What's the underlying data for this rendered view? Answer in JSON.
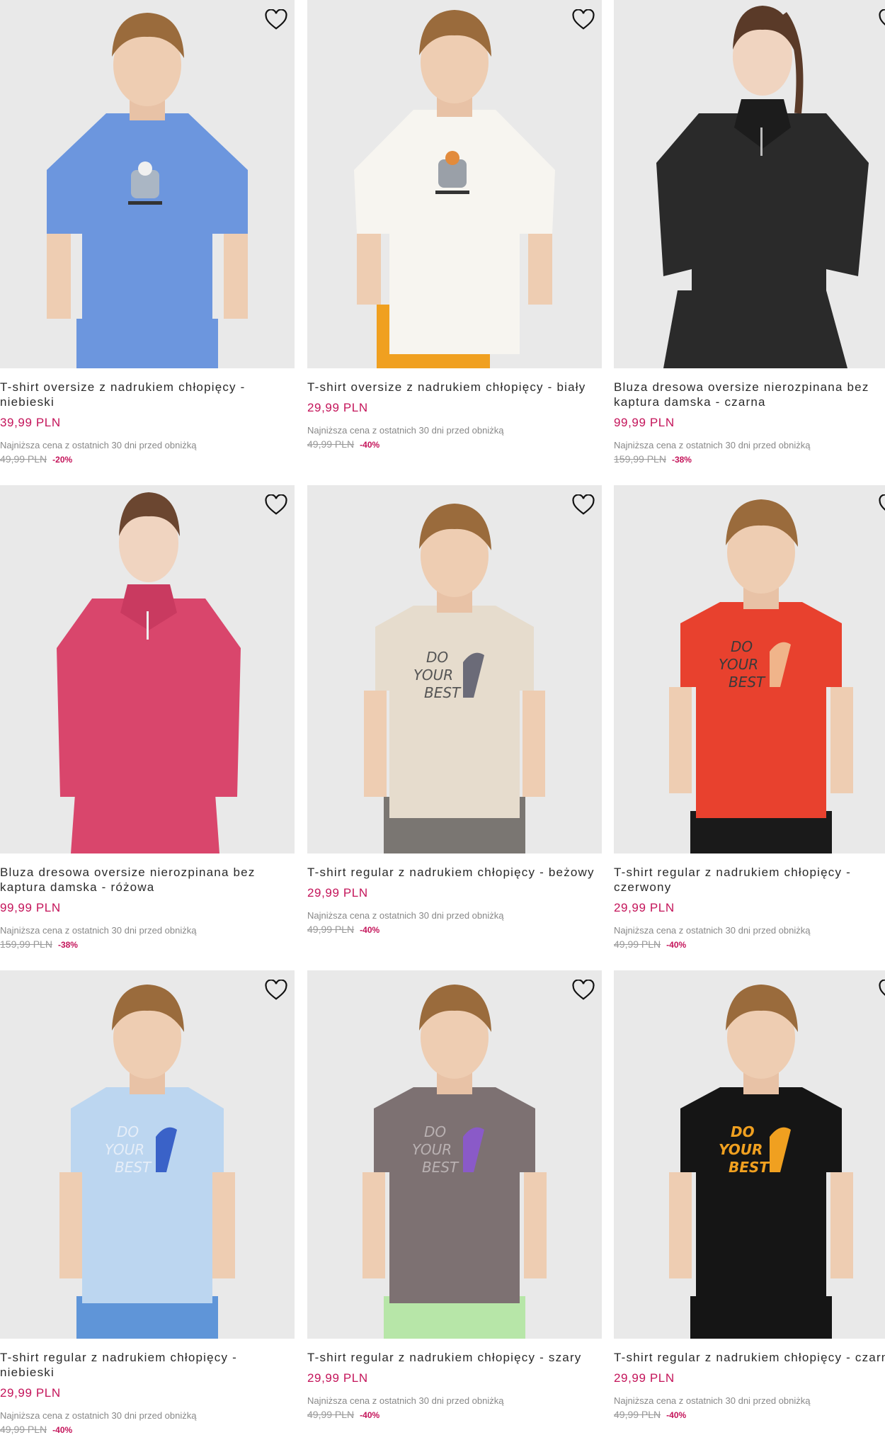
{
  "colors": {
    "price": "#c4145a",
    "card_bg": "#e9e9e9"
  },
  "products": [
    {
      "title": "T-shirt oversize z nadrukiem chłopięcy - niebieski",
      "price": "39,99 PLN",
      "lowest_label": "Najniższa cena z ostatnich 30 dni przed obniżką",
      "old_price": "49,99 PLN",
      "discount": "-20%",
      "shirt_color": "#6c96de",
      "print": "skater",
      "person": "boy",
      "bottom": "#6c96de"
    },
    {
      "title": "T-shirt oversize z nadrukiem chłopięcy - biały",
      "price": "29,99 PLN",
      "lowest_label": "Najniższa cena z ostatnich 30 dni przed obniżką",
      "old_price": "49,99 PLN",
      "discount": "-40%",
      "shirt_color": "#f7f5f0",
      "print": "skater",
      "person": "boy",
      "bottom": "#f0a020"
    },
    {
      "title": "Bluza dresowa oversize nierozpinana bez kaptura damska - czarna",
      "price": "99,99 PLN",
      "lowest_label": "Najniższa cena z ostatnich 30 dni przed obniżką",
      "old_price": "159,99 PLN",
      "discount": "-38%",
      "shirt_color": "#2a2a2a",
      "print": "zip",
      "person": "woman",
      "bottom": "#2a2a2a"
    },
    {
      "title": "Bluza dresowa oversize nierozpinana bez kaptura damska - różowa",
      "price": "99,99 PLN",
      "lowest_label": "Najniższa cena z ostatnich 30 dni przed obniżką",
      "old_price": "159,99 PLN",
      "discount": "-38%",
      "shirt_color": "#d9466c",
      "print": "zip",
      "person": "woman",
      "bottom": "#d9466c"
    },
    {
      "title": "T-shirt regular z nadrukiem chłopięcy - beżowy",
      "price": "29,99 PLN",
      "lowest_label": "Najniższa cena z ostatnich 30 dni przed obniżką",
      "old_price": "49,99 PLN",
      "discount": "-40%",
      "shirt_color": "#e6dccd",
      "print": "text",
      "person": "boy",
      "bottom": "#7a7672"
    },
    {
      "title": "T-shirt regular z nadrukiem chłopięcy - czerwony",
      "price": "29,99 PLN",
      "lowest_label": "Najniższa cena z ostatnich 30 dni przed obniżką",
      "old_price": "49,99 PLN",
      "discount": "-40%",
      "shirt_color": "#e8412e",
      "print": "text",
      "person": "boy",
      "bottom": "#1a1a1a"
    },
    {
      "title": "T-shirt regular z nadrukiem chłopięcy - niebieski",
      "price": "29,99 PLN",
      "lowest_label": "Najniższa cena z ostatnich 30 dni przed obniżką",
      "old_price": "49,99 PLN",
      "discount": "-40%",
      "shirt_color": "#bcd6f0",
      "print": "text",
      "person": "boy",
      "bottom": "#5f95d8"
    },
    {
      "title": "T-shirt regular z nadrukiem chłopięcy - szary",
      "price": "29,99 PLN",
      "lowest_label": "Najniższa cena z ostatnich 30 dni przed obniżką",
      "old_price": "49,99 PLN",
      "discount": "-40%",
      "shirt_color": "#7d7172",
      "print": "text",
      "person": "boy",
      "bottom": "#b7e6a8"
    },
    {
      "title": "T-shirt regular z nadrukiem chłopięcy - czarny",
      "price": "29,99 PLN",
      "lowest_label": "Najniższa cena z ostatnich 30 dni przed obniżką",
      "old_price": "49,99 PLN",
      "discount": "-40%",
      "shirt_color": "#151515",
      "print": "text",
      "person": "boy",
      "bottom": "#151515"
    }
  ],
  "icons": {
    "favorite": "heart-outline-icon"
  }
}
